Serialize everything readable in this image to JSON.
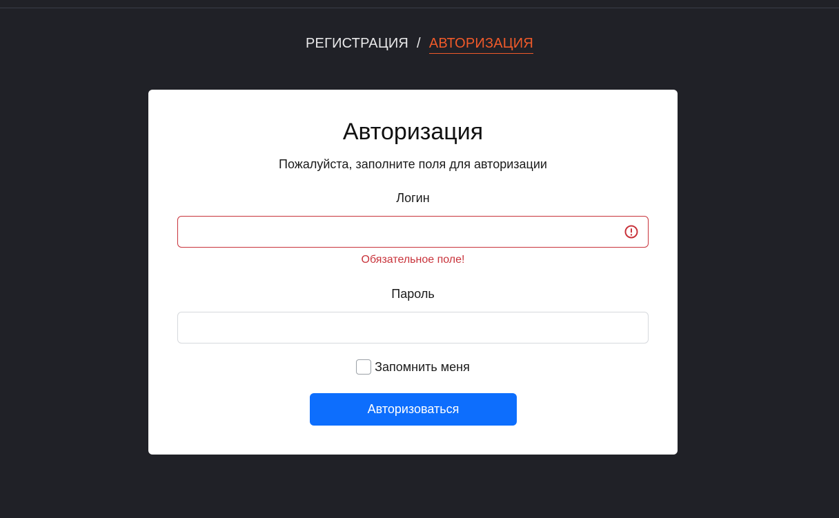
{
  "nav": {
    "register_label": "РЕГИСТРАЦИЯ",
    "separator": "/",
    "login_label": "АВТОРИЗАЦИЯ"
  },
  "form": {
    "title": "Авторизация",
    "subtitle": "Пожалуйста, заполните поля для авторизации",
    "login_label": "Логин",
    "login_value": "",
    "login_error": "Обязательное поле!",
    "password_label": "Пароль",
    "password_value": "",
    "remember_label": "Запомнить меня",
    "remember_checked": false,
    "submit_label": "Авторизоваться"
  },
  "icons": {
    "login_status": "exclamation-circle-icon"
  },
  "colors": {
    "background": "#202127",
    "accent_nav": "#f05a2a",
    "error": "#c8323a",
    "primary_button": "#0d6efd"
  }
}
